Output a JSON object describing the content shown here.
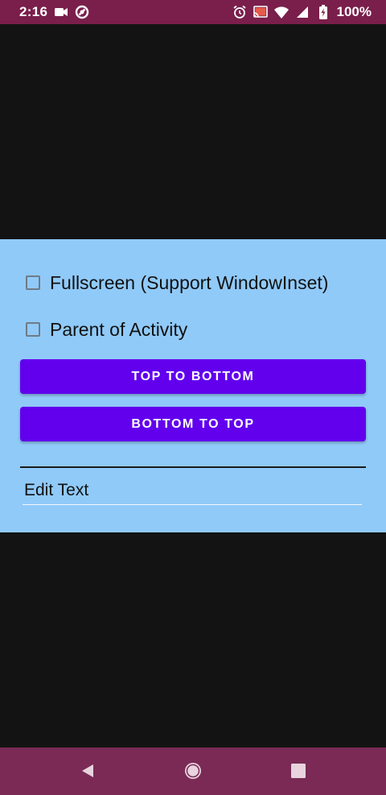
{
  "status_bar": {
    "time": "2:16",
    "battery_text": "100%",
    "left_icons": [
      "video-camera-icon",
      "do-not-disturb-icon"
    ],
    "right_icons": [
      "alarm-icon",
      "cast-icon",
      "wifi-icon",
      "cellular-signal-icon",
      "battery-charging-icon"
    ],
    "background_color": "#7a1e4b"
  },
  "panel": {
    "background_color": "#90caf9",
    "checkboxes": [
      {
        "label": "Fullscreen (Support WindowInset)",
        "checked": false
      },
      {
        "label": "Parent of Activity",
        "checked": false
      }
    ],
    "buttons": [
      {
        "label": "TOP TO BOTTOM"
      },
      {
        "label": "BOTTOM TO TOP"
      }
    ],
    "button_color": "#6200ee",
    "edit_text": {
      "value": "",
      "placeholder": "Edit Text"
    }
  },
  "nav_bar": {
    "items": [
      "back-icon",
      "home-icon",
      "recents-icon"
    ],
    "background_color": "#7a2a55"
  }
}
